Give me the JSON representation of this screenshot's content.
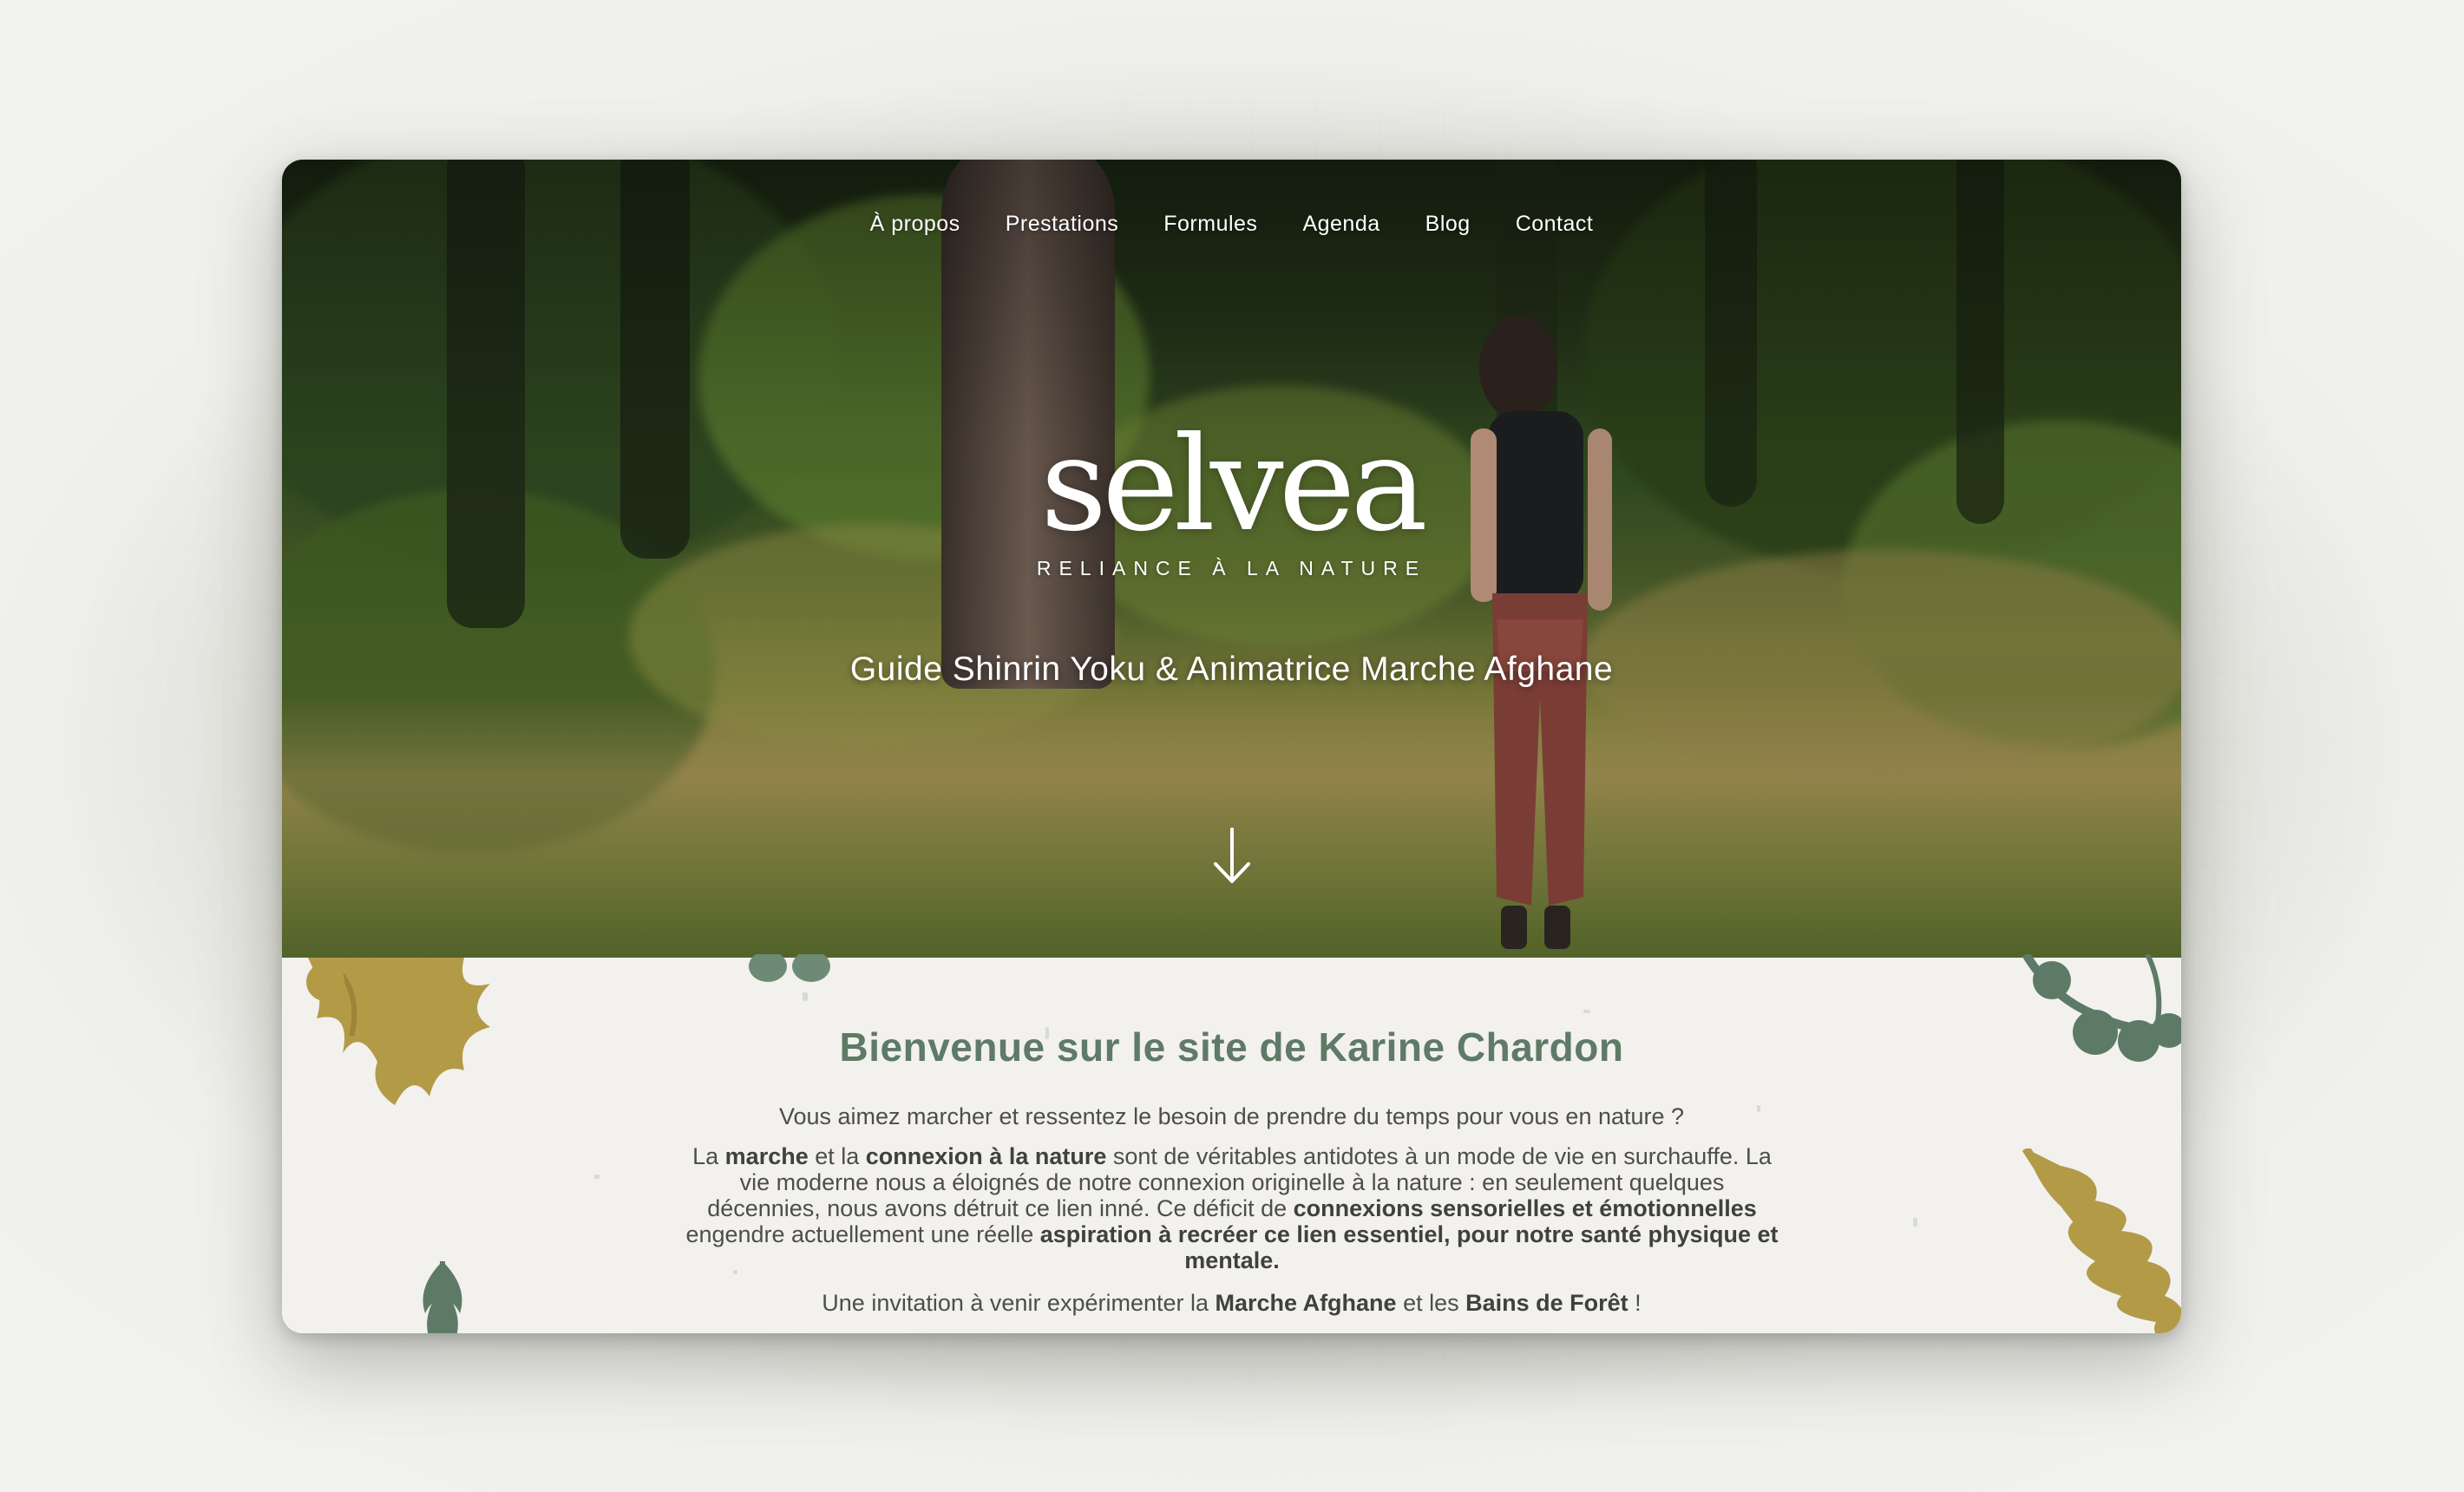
{
  "nav": {
    "items": [
      "À propos",
      "Prestations",
      "Formules",
      "Agenda",
      "Blog",
      "Contact"
    ]
  },
  "hero": {
    "logo_word": "selvea",
    "logo_tagline": "RELIANCE À LA NATURE",
    "subtitle": "Guide Shinrin Yoku & Animatrice Marche Afghane",
    "scroll_icon": "arrow-down-icon"
  },
  "content": {
    "title": "Bienvenue sur le site de Karine Chardon",
    "intro": "Vous aimez marcher et ressentez le besoin de prendre du temps pour vous en nature ?",
    "body": {
      "t1": "La ",
      "b1": "marche",
      "t2": " et la ",
      "b2": "connexion à la nature",
      "t3": " sont de véritables antidotes à un mode de vie en surchauffe. La vie moderne nous a éloignés de notre connexion originelle à la nature : en seulement quelques décennies, nous avons détruit ce lien inné. Ce déficit de ",
      "b3": "connexions sensorielles et émotionnelles",
      "t4": " engendre actuellement une réelle ",
      "b4": "aspiration à recréer ce lien essentiel, pour notre santé physique et mentale."
    },
    "invite": {
      "t1": "Une invitation à venir expérimenter la ",
      "b1": "Marche Afghane",
      "t2": " et les ",
      "b2": "Bains de Forêt",
      "t3": " !"
    }
  },
  "colors": {
    "title_green": "#5f7a66",
    "ochre": "#b39a47",
    "sage": "#6d8a74",
    "paper": "#f2f1ee"
  }
}
